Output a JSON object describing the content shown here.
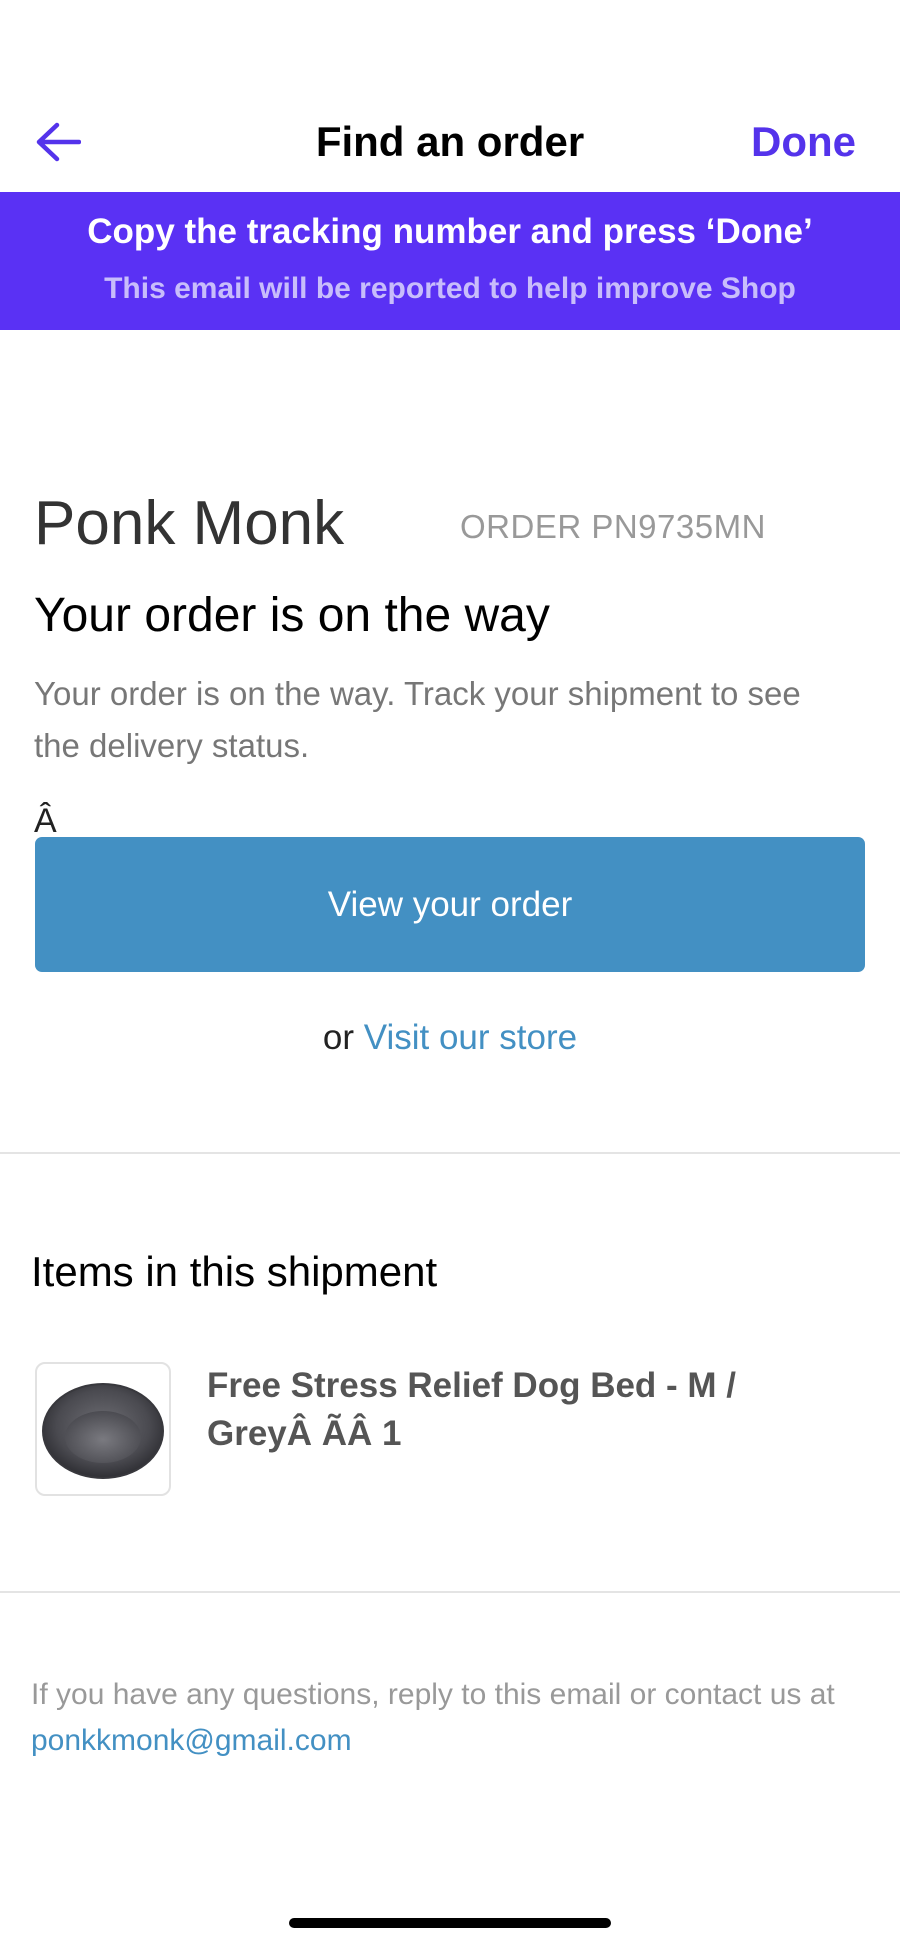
{
  "navbar": {
    "back_icon": "arrow-left-icon",
    "title": "Find an order",
    "done_label": "Done",
    "accent_color": "#5433eb"
  },
  "banner": {
    "title": "Copy the tracking number and press ‘Done’",
    "subtitle": "This email will be reported to help improve Shop",
    "background_color": "#5a31f4"
  },
  "order": {
    "store_name": "Ponk Monk",
    "order_number": "ORDER PN9735MN",
    "headline": "Your order is on the way",
    "description": "Your order is on the way. Track your shipment to see the delivery status.",
    "stray_char": "Â",
    "view_button_label": "View your order",
    "button_color": "#4390c3",
    "visit_prefix": "or",
    "visit_link": "Visit our store"
  },
  "shipment": {
    "title": "Items in this shipment",
    "items": [
      {
        "name": "Free Stress Relief Dog Bed - M / GreyÂ ÃÂ 1",
        "image_icon": "dog-bed-image"
      }
    ]
  },
  "footer": {
    "text": "If you have any questions, reply to this email or contact us at",
    "email": "ponkkmonk@gmail.com"
  }
}
